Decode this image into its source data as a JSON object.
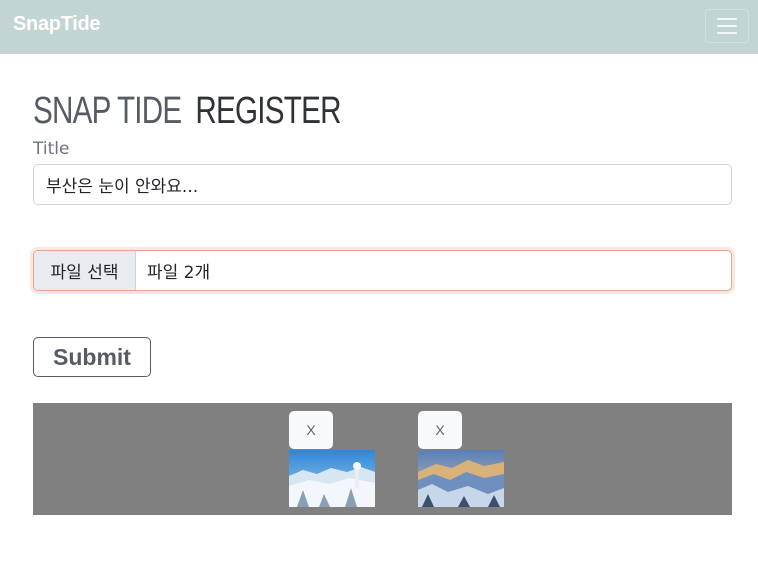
{
  "navbar": {
    "brand": "SnapTide",
    "toggle_icon": "hamburger-menu-icon"
  },
  "heading": {
    "brand": "SNAP TIDE",
    "register": "REGISTER"
  },
  "form": {
    "title_label": "Title",
    "title_value": "부산은 눈이 안와요...",
    "file_button": "파일 선택",
    "file_status": "파일 2개",
    "submit_label": "Submit"
  },
  "preview": {
    "items": [
      {
        "remove_label": "X",
        "image": "snowy-mountain-photo"
      },
      {
        "remove_label": "X",
        "image": "snowy-valley-photo"
      }
    ]
  },
  "colors": {
    "navbar_bg": "#c3d4d4",
    "preview_bg": "#808080",
    "focus_border": "#e8a58e",
    "heading_brand": "#555c63"
  }
}
